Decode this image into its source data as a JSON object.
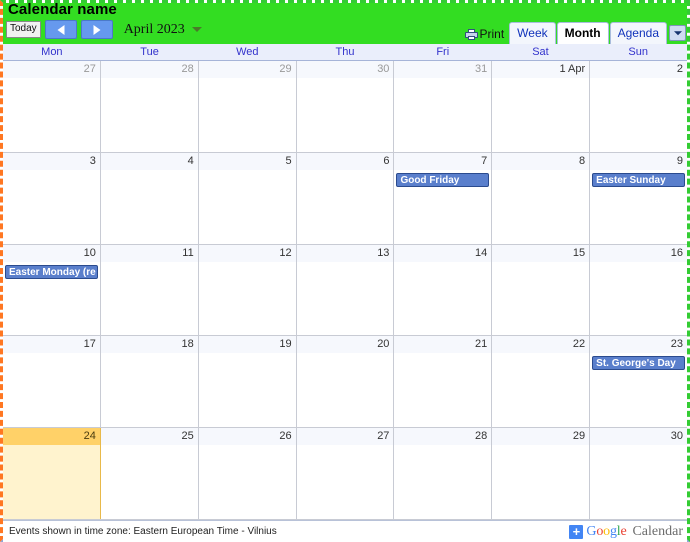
{
  "header": {
    "calendar_name": "Calendar name",
    "today_button": "Today",
    "prev_label": "Previous period",
    "next_label": "Next period",
    "period": "April 2023",
    "print_label": "Print",
    "tabs": [
      {
        "label": "Week",
        "active": false
      },
      {
        "label": "Month",
        "active": true
      },
      {
        "label": "Agenda",
        "active": false
      }
    ],
    "accent_green": "#33dd22",
    "accent_blue": "#6699ee"
  },
  "weekdays": [
    "Mon",
    "Tue",
    "Wed",
    "Thu",
    "Fri",
    "Sat",
    "Sun"
  ],
  "grid": {
    "weeks": [
      [
        {
          "num": "27",
          "other_month": true,
          "today": false,
          "events": []
        },
        {
          "num": "28",
          "other_month": true,
          "today": false,
          "events": []
        },
        {
          "num": "29",
          "other_month": true,
          "today": false,
          "events": []
        },
        {
          "num": "30",
          "other_month": true,
          "today": false,
          "events": []
        },
        {
          "num": "31",
          "other_month": true,
          "today": false,
          "events": []
        },
        {
          "num": "1 Apr",
          "other_month": false,
          "today": false,
          "events": []
        },
        {
          "num": "2",
          "other_month": false,
          "today": false,
          "events": []
        }
      ],
      [
        {
          "num": "3",
          "other_month": false,
          "today": false,
          "events": []
        },
        {
          "num": "4",
          "other_month": false,
          "today": false,
          "events": []
        },
        {
          "num": "5",
          "other_month": false,
          "today": false,
          "events": []
        },
        {
          "num": "6",
          "other_month": false,
          "today": false,
          "events": []
        },
        {
          "num": "7",
          "other_month": false,
          "today": false,
          "events": [
            "Good Friday"
          ]
        },
        {
          "num": "8",
          "other_month": false,
          "today": false,
          "events": []
        },
        {
          "num": "9",
          "other_month": false,
          "today": false,
          "events": [
            "Easter Sunday"
          ]
        }
      ],
      [
        {
          "num": "10",
          "other_month": false,
          "today": false,
          "events": [
            "Easter Monday (re"
          ]
        },
        {
          "num": "11",
          "other_month": false,
          "today": false,
          "events": []
        },
        {
          "num": "12",
          "other_month": false,
          "today": false,
          "events": []
        },
        {
          "num": "13",
          "other_month": false,
          "today": false,
          "events": []
        },
        {
          "num": "14",
          "other_month": false,
          "today": false,
          "events": []
        },
        {
          "num": "15",
          "other_month": false,
          "today": false,
          "events": []
        },
        {
          "num": "16",
          "other_month": false,
          "today": false,
          "events": []
        }
      ],
      [
        {
          "num": "17",
          "other_month": false,
          "today": false,
          "events": []
        },
        {
          "num": "18",
          "other_month": false,
          "today": false,
          "events": []
        },
        {
          "num": "19",
          "other_month": false,
          "today": false,
          "events": []
        },
        {
          "num": "20",
          "other_month": false,
          "today": false,
          "events": []
        },
        {
          "num": "21",
          "other_month": false,
          "today": false,
          "events": []
        },
        {
          "num": "22",
          "other_month": false,
          "today": false,
          "events": []
        },
        {
          "num": "23",
          "other_month": false,
          "today": false,
          "events": [
            "St. George's Day"
          ]
        }
      ],
      [
        {
          "num": "24",
          "other_month": false,
          "today": true,
          "events": []
        },
        {
          "num": "25",
          "other_month": false,
          "today": false,
          "events": []
        },
        {
          "num": "26",
          "other_month": false,
          "today": false,
          "events": []
        },
        {
          "num": "27",
          "other_month": false,
          "today": false,
          "events": []
        },
        {
          "num": "28",
          "other_month": false,
          "today": false,
          "events": []
        },
        {
          "num": "29",
          "other_month": false,
          "today": false,
          "events": []
        },
        {
          "num": "30",
          "other_month": false,
          "today": false,
          "events": []
        }
      ]
    ]
  },
  "footer": {
    "timezone_text": "Events shown in time zone: Eastern European Time - Vilnius",
    "plus_label": "+",
    "brand_letters": [
      "G",
      "o",
      "o",
      "g",
      "l",
      "e"
    ],
    "brand_suffix": "Calendar"
  }
}
